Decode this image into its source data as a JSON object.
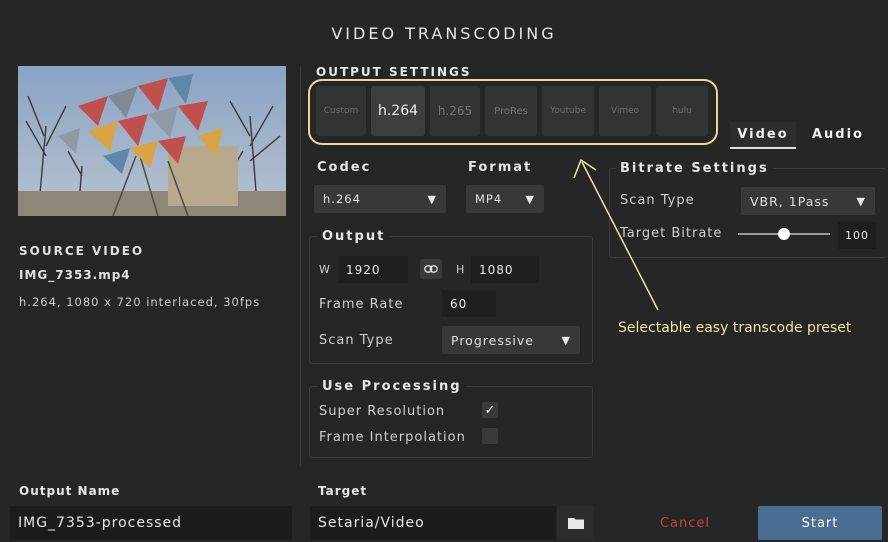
{
  "window": {
    "title": "VIDEO TRANSCODING"
  },
  "source": {
    "heading": "SOURCE VIDEO",
    "filename": "IMG_7353.mp4",
    "info": "h.264, 1080 x 720 interlaced, 30fps"
  },
  "output_settings": {
    "heading": "OUTPUT SETTINGS",
    "presets": [
      {
        "label": "Custom",
        "selected": false
      },
      {
        "label": "h.264",
        "selected": true
      },
      {
        "label": "h.265",
        "selected": false
      },
      {
        "label": "ProRes",
        "selected": false
      },
      {
        "label": "Youtube",
        "selected": false
      },
      {
        "label": "Vimeo",
        "selected": false
      },
      {
        "label": "hulu",
        "selected": false
      }
    ],
    "tabs": [
      {
        "label": "Video",
        "active": true
      },
      {
        "label": "Audio",
        "active": false
      }
    ]
  },
  "codec": {
    "label": "Codec",
    "value": "h.264"
  },
  "format": {
    "label": "Format",
    "value": "MP4"
  },
  "output": {
    "heading": "Output",
    "width_label": "W",
    "width": "1920",
    "height_label": "H",
    "height": "1080",
    "frame_rate_label": "Frame Rate",
    "frame_rate": "60",
    "scan_type_label": "Scan Type",
    "scan_type": "Progressive"
  },
  "processing": {
    "heading": "Use Processing",
    "super_resolution_label": "Super Resolution",
    "super_resolution": true,
    "frame_interpolation_label": "Frame Interpolation",
    "frame_interpolation": false
  },
  "bitrate": {
    "heading": "Bitrate Settings",
    "scan_type_label": "Scan Type",
    "scan_type": "VBR, 1Pass",
    "target_label": "Target Bitrate",
    "target_value": "100",
    "slider_fraction": 0.5
  },
  "annotation": "Selectable easy transcode preset",
  "bottom": {
    "output_name_label": "Output Name",
    "output_name": "IMG_7353-processed",
    "target_label": "Target",
    "target": "Setaria/Video",
    "cancel": "Cancel",
    "start": "Start"
  },
  "icons": {
    "folder": "folder-icon",
    "link": "link-icon",
    "check": "checkmark-icon",
    "dropdown": "caret-down-icon"
  },
  "colors": {
    "background": "#262626",
    "annotation": "#f1e6a6",
    "cancel": "#c0443f",
    "start_button": "#4a6d93"
  }
}
